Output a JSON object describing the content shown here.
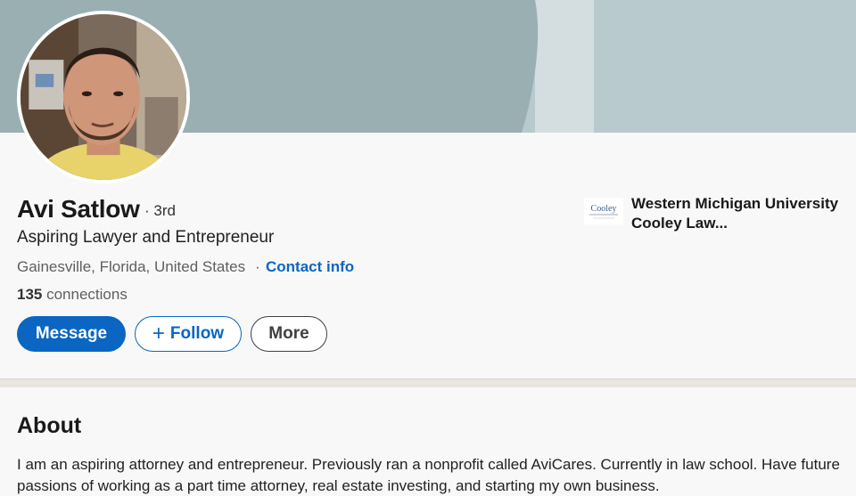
{
  "profile": {
    "name": "Avi Satlow",
    "degree": "· 3rd",
    "headline": "Aspiring Lawyer and Entrepreneur",
    "location": "Gainesville, Florida, United States",
    "separator": "·",
    "contact_info": "Contact info",
    "connections_count": "135",
    "connections_label": " connections"
  },
  "actions": {
    "message": "Message",
    "follow_plus": "+",
    "follow": "Follow",
    "more": "More"
  },
  "education": {
    "school": "Western Michigan University Cooley Law...",
    "logo_text": "Cooley"
  },
  "about": {
    "title": "About",
    "text": "I am an aspiring attorney and entrepreneur. Previously ran a nonprofit called AviCares. Currently in law school. Have future passions of working as a part time attorney, real estate investing, and starting my own business."
  },
  "colors": {
    "brand_blue": "#0a66c2",
    "banner_dark": "#9aafb2",
    "banner_light": "#b8cacd"
  }
}
